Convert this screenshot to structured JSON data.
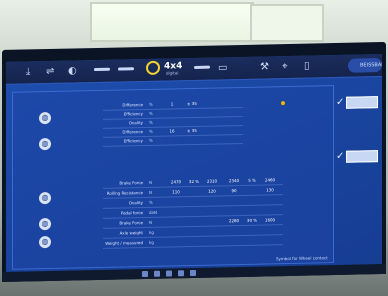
{
  "toolbar": {
    "icons": [
      "download-icon",
      "car-icon",
      "palette-icon",
      "logo-icon",
      "keyboard-icon",
      "tools-icon",
      "pin-icon",
      "battery-icon"
    ],
    "mode_label": "4x4",
    "mode_sub": "digital",
    "brand_right": "BEISSBARTH"
  },
  "sections": {
    "top_title": "",
    "bottom_title": ""
  },
  "top_table": {
    "rows": [
      {
        "label": "Difference",
        "unit": "%",
        "values": [
          "1",
          "± 35",
          "",
          ""
        ]
      },
      {
        "label": "Efficiency",
        "unit": "%",
        "values": [
          "",
          "",
          "",
          ""
        ]
      },
      {
        "label": "Ovality",
        "unit": "%",
        "values": [
          "",
          "",
          "",
          ""
        ]
      },
      {
        "label": "Difference",
        "unit": "%",
        "values": [
          "16",
          "± 35",
          "",
          ""
        ]
      },
      {
        "label": "Efficiency",
        "unit": "%",
        "values": [
          "",
          "",
          "",
          ""
        ]
      }
    ]
  },
  "bottom_table": {
    "headers": [
      "",
      "",
      "",
      "",
      "",
      ""
    ],
    "rows": [
      {
        "label": "Brake Force",
        "unit": "N",
        "values": [
          "2470",
          "32 %",
          "2310",
          "2340",
          "5 %",
          "2460"
        ]
      },
      {
        "label": "Rolling Resistance",
        "unit": "N",
        "values": [
          "110",
          "",
          "120",
          "90",
          "",
          "130"
        ]
      },
      {
        "label": "Ovality",
        "unit": "%",
        "values": [
          "",
          "",
          "",
          "",
          "",
          ""
        ]
      },
      {
        "label": "Pedal force",
        "unit": "daN",
        "values": [
          "",
          "",
          "",
          "",
          "",
          ""
        ]
      },
      {
        "label": "Brake Force",
        "unit": "N",
        "values": [
          "",
          "",
          "",
          "2280",
          "30 %",
          "1600"
        ]
      },
      {
        "label": "Axle weight",
        "unit": "kg",
        "values": [
          "",
          "",
          "",
          "",
          "",
          ""
        ]
      },
      {
        "label": "Weight / measured",
        "unit": "kg",
        "values": [
          "",
          "",
          "",
          "",
          "",
          ""
        ]
      }
    ]
  },
  "side": {
    "tags": [
      "",
      ""
    ]
  },
  "footer": {
    "note": "Symbol for Wheel contact"
  },
  "colors": {
    "screen_bg": "#1a45a0",
    "toolbar_bg": "#14244d",
    "accent_yellow": "#f2d230"
  }
}
